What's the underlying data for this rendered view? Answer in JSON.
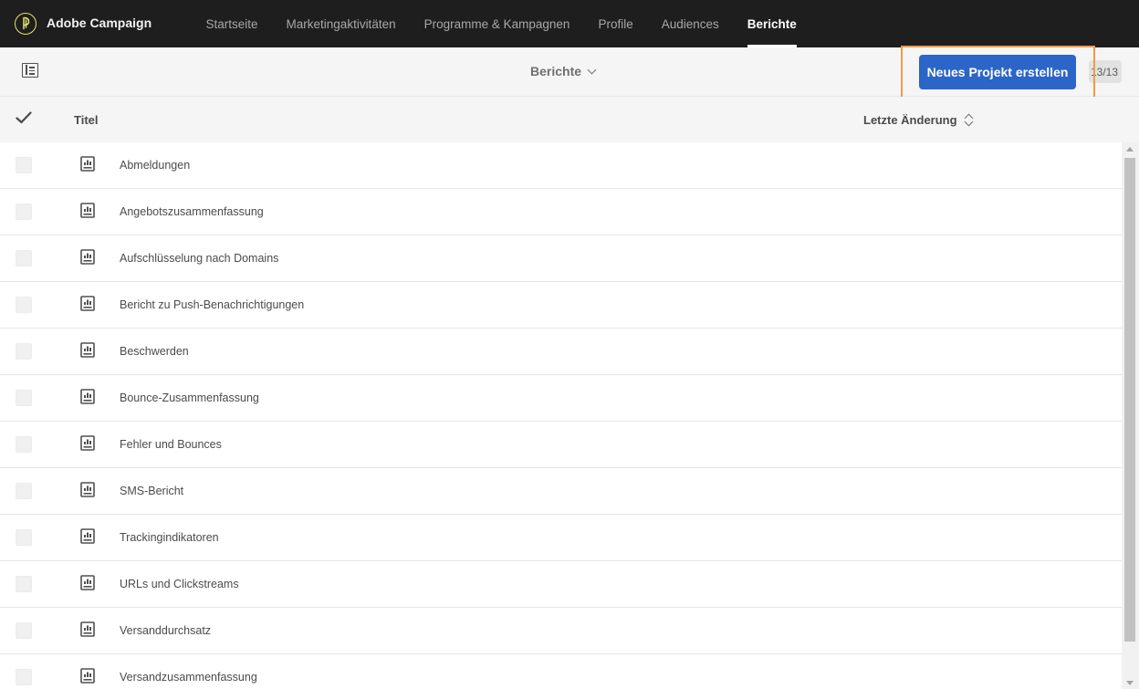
{
  "app": {
    "brand": "Adobe Campaign",
    "logo_icon": "adobe-campaign-logo-icon",
    "accent_color": "#2c65c8",
    "highlight_color": "#f09a48"
  },
  "nav": {
    "items": [
      {
        "label": "Startseite",
        "active": false
      },
      {
        "label": "Marketingaktivitäten",
        "active": false
      },
      {
        "label": "Programme & Kampagnen",
        "active": false
      },
      {
        "label": "Profile",
        "active": false
      },
      {
        "label": "Audiences",
        "active": false
      },
      {
        "label": "Berichte",
        "active": true
      }
    ]
  },
  "toolbar": {
    "panel_icon": "panel-toggle-icon",
    "view_title": "Berichte",
    "new_button_label": "Neues Projekt erstellen",
    "counter": "13/13"
  },
  "list": {
    "select_all_icon": "checkmark-icon",
    "columns": {
      "title": "Titel",
      "modified": "Letzte Änderung"
    },
    "row_icon": "report-icon",
    "rows": [
      {
        "title": "Abmeldungen"
      },
      {
        "title": "Angebotszusammenfassung"
      },
      {
        "title": "Aufschlüsselung nach Domains"
      },
      {
        "title": "Bericht zu Push-Benachrichtigungen"
      },
      {
        "title": "Beschwerden"
      },
      {
        "title": "Bounce-Zusammenfassung"
      },
      {
        "title": "Fehler und Bounces"
      },
      {
        "title": "SMS-Bericht"
      },
      {
        "title": "Trackingindikatoren"
      },
      {
        "title": "URLs und Clickstreams"
      },
      {
        "title": "Versanddurchsatz"
      },
      {
        "title": "Versandzusammenfassung"
      }
    ]
  }
}
